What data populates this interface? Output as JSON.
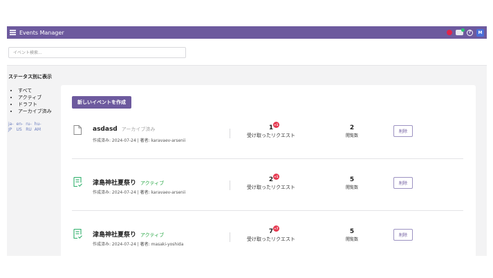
{
  "app": {
    "title": "Events Manager",
    "avatar_initial": "M",
    "help_glyph": "?",
    "accent_color": "#6d5a9e"
  },
  "search": {
    "placeholder": "イベント検索..."
  },
  "sidebar": {
    "title": "ステータス別に表示",
    "filters": [
      "すべて",
      "アクティブ",
      "ドラフト",
      "アーカイブ済み"
    ],
    "languages": [
      {
        "code": "ja-",
        "region": "JP"
      },
      {
        "code": "en-",
        "region": "US"
      },
      {
        "code": "ru-",
        "region": "RU"
      },
      {
        "code": "hu-",
        "region": "AM"
      }
    ]
  },
  "main": {
    "create_button": "新しいイベントを作成",
    "events": [
      {
        "name": "asdasd",
        "status": "アーカイブ済み",
        "icon": "document-icon",
        "created_label": "作成済み: 2024-07-24 | 著者: karavaev-arsenii",
        "requests": "1",
        "requests_badge": "+1",
        "requests_label": "受け取ったリクエスト",
        "views": "2",
        "views_label": "閲覧数",
        "delete_label": "削除"
      },
      {
        "name": "津島神社夏祭り",
        "status": "アクティブ",
        "icon": "form-check-icon",
        "created_label": "作成済み: 2024-07-24 | 著者: karavaev-arsenii",
        "requests": "2",
        "requests_badge": "+1",
        "requests_label": "受け取ったリクエスト",
        "views": "5",
        "views_label": "閲覧数",
        "delete_label": "削除"
      },
      {
        "name": "津島神社夏祭り",
        "status": "アクティブ",
        "icon": "form-check-icon",
        "created_label": "作成済み: 2024-07-24 | 著者: masaki-yoshida",
        "requests": "7",
        "requests_badge": "+7",
        "requests_label": "受け取ったリクエスト",
        "views": "5",
        "views_label": "閲覧数",
        "delete_label": "削除"
      }
    ]
  }
}
